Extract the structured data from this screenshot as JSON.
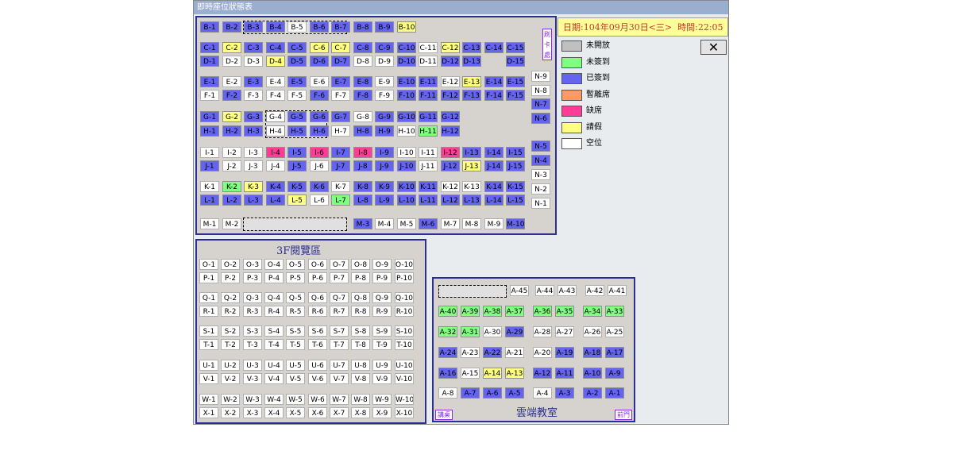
{
  "window": {
    "title": "即時座位狀態表"
  },
  "status": {
    "date_label": "日期:104年09月30日<三>",
    "time_label": "時間:22:05"
  },
  "close_label": "✕",
  "colors": {
    "closed": "#c0c0c0",
    "not_arrived": "#80ff80",
    "checked_in": "#6464f0",
    "away": "#ff9966",
    "absent": "#ff3c96",
    "leave": "#ffff80",
    "empty": "#ffffff"
  },
  "legend": [
    {
      "status": "closed",
      "label": "未開放"
    },
    {
      "status": "not_arrived",
      "label": "未簽到"
    },
    {
      "status": "checked_in",
      "label": "已簽到"
    },
    {
      "status": "away",
      "label": "暫離席"
    },
    {
      "status": "absent",
      "label": "缺席"
    },
    {
      "status": "leave",
      "label": "請假"
    },
    {
      "status": "empty",
      "label": "空位"
    }
  ],
  "card_reader_label": "刷卡處",
  "zones": {
    "browse": "3F閱覽區",
    "cloud": "雲端教室"
  },
  "tags": {
    "podium": "講桌",
    "front_door": "前門"
  },
  "seat_rows": {
    "B": "uu..uuwuuuuy",
    "C": "uyuuuyyuuuwyuu",
    "D": "uwwyuuuwwuwuu",
    "E": "uwuwuwuuwuuwyuu",
    "F": "wuwwwuwuwuuuuu",
    "G": "uyu.uuuwuuuu",
    "H": "uuu.uuwuuwgu",
    "I": "wwwpupupuwwpuuu",
    "J": "uwwwuwuuuuwuyu",
    "K": "wgyuuuwuuuuwwu",
    "L": "uuuuywguuuuuuu",
    "M": "ww.uwwuwwwu",
    "N": "uuwwuuuwu",
    "browse": "wwwwwwwwww"
  },
  "cloud_rows": [
    [
      "A-45",
      "w",
      "A-44",
      "w",
      "A-43",
      "w",
      "A-42",
      "w",
      "A-41",
      "w"
    ],
    [
      "A-40",
      "g",
      "A-39",
      "g",
      "A-38",
      "g",
      "A-37",
      "g",
      "A-36",
      "g",
      "A-35",
      "g",
      "A-34",
      "g",
      "A-33",
      "g"
    ],
    [
      "A-32",
      "g",
      "A-31",
      "g",
      "A-30",
      "w",
      "A-29",
      "u",
      "A-28",
      "w",
      "A-27",
      "w",
      "A-26",
      "w",
      "A-25",
      "w"
    ],
    [
      "A-24",
      "u",
      "A-23",
      "w",
      "A-22",
      "u",
      "A-21",
      "w",
      "A-20",
      "w",
      "A-19",
      "u",
      "A-18",
      "u",
      "A-17",
      "u"
    ],
    [
      "A-16",
      "u",
      "A-15",
      "w",
      "A-14",
      "y",
      "A-13",
      "y",
      "A-12",
      "u",
      "A-11",
      "u",
      "A-10",
      "u",
      "A-9",
      "u"
    ],
    [
      "A-8",
      "w",
      "A-7",
      "u",
      "A-6",
      "u",
      "A-5",
      "u",
      "A-4",
      "w",
      "A-3",
      "u",
      "A-2",
      "u",
      "A-1",
      "u"
    ]
  ]
}
